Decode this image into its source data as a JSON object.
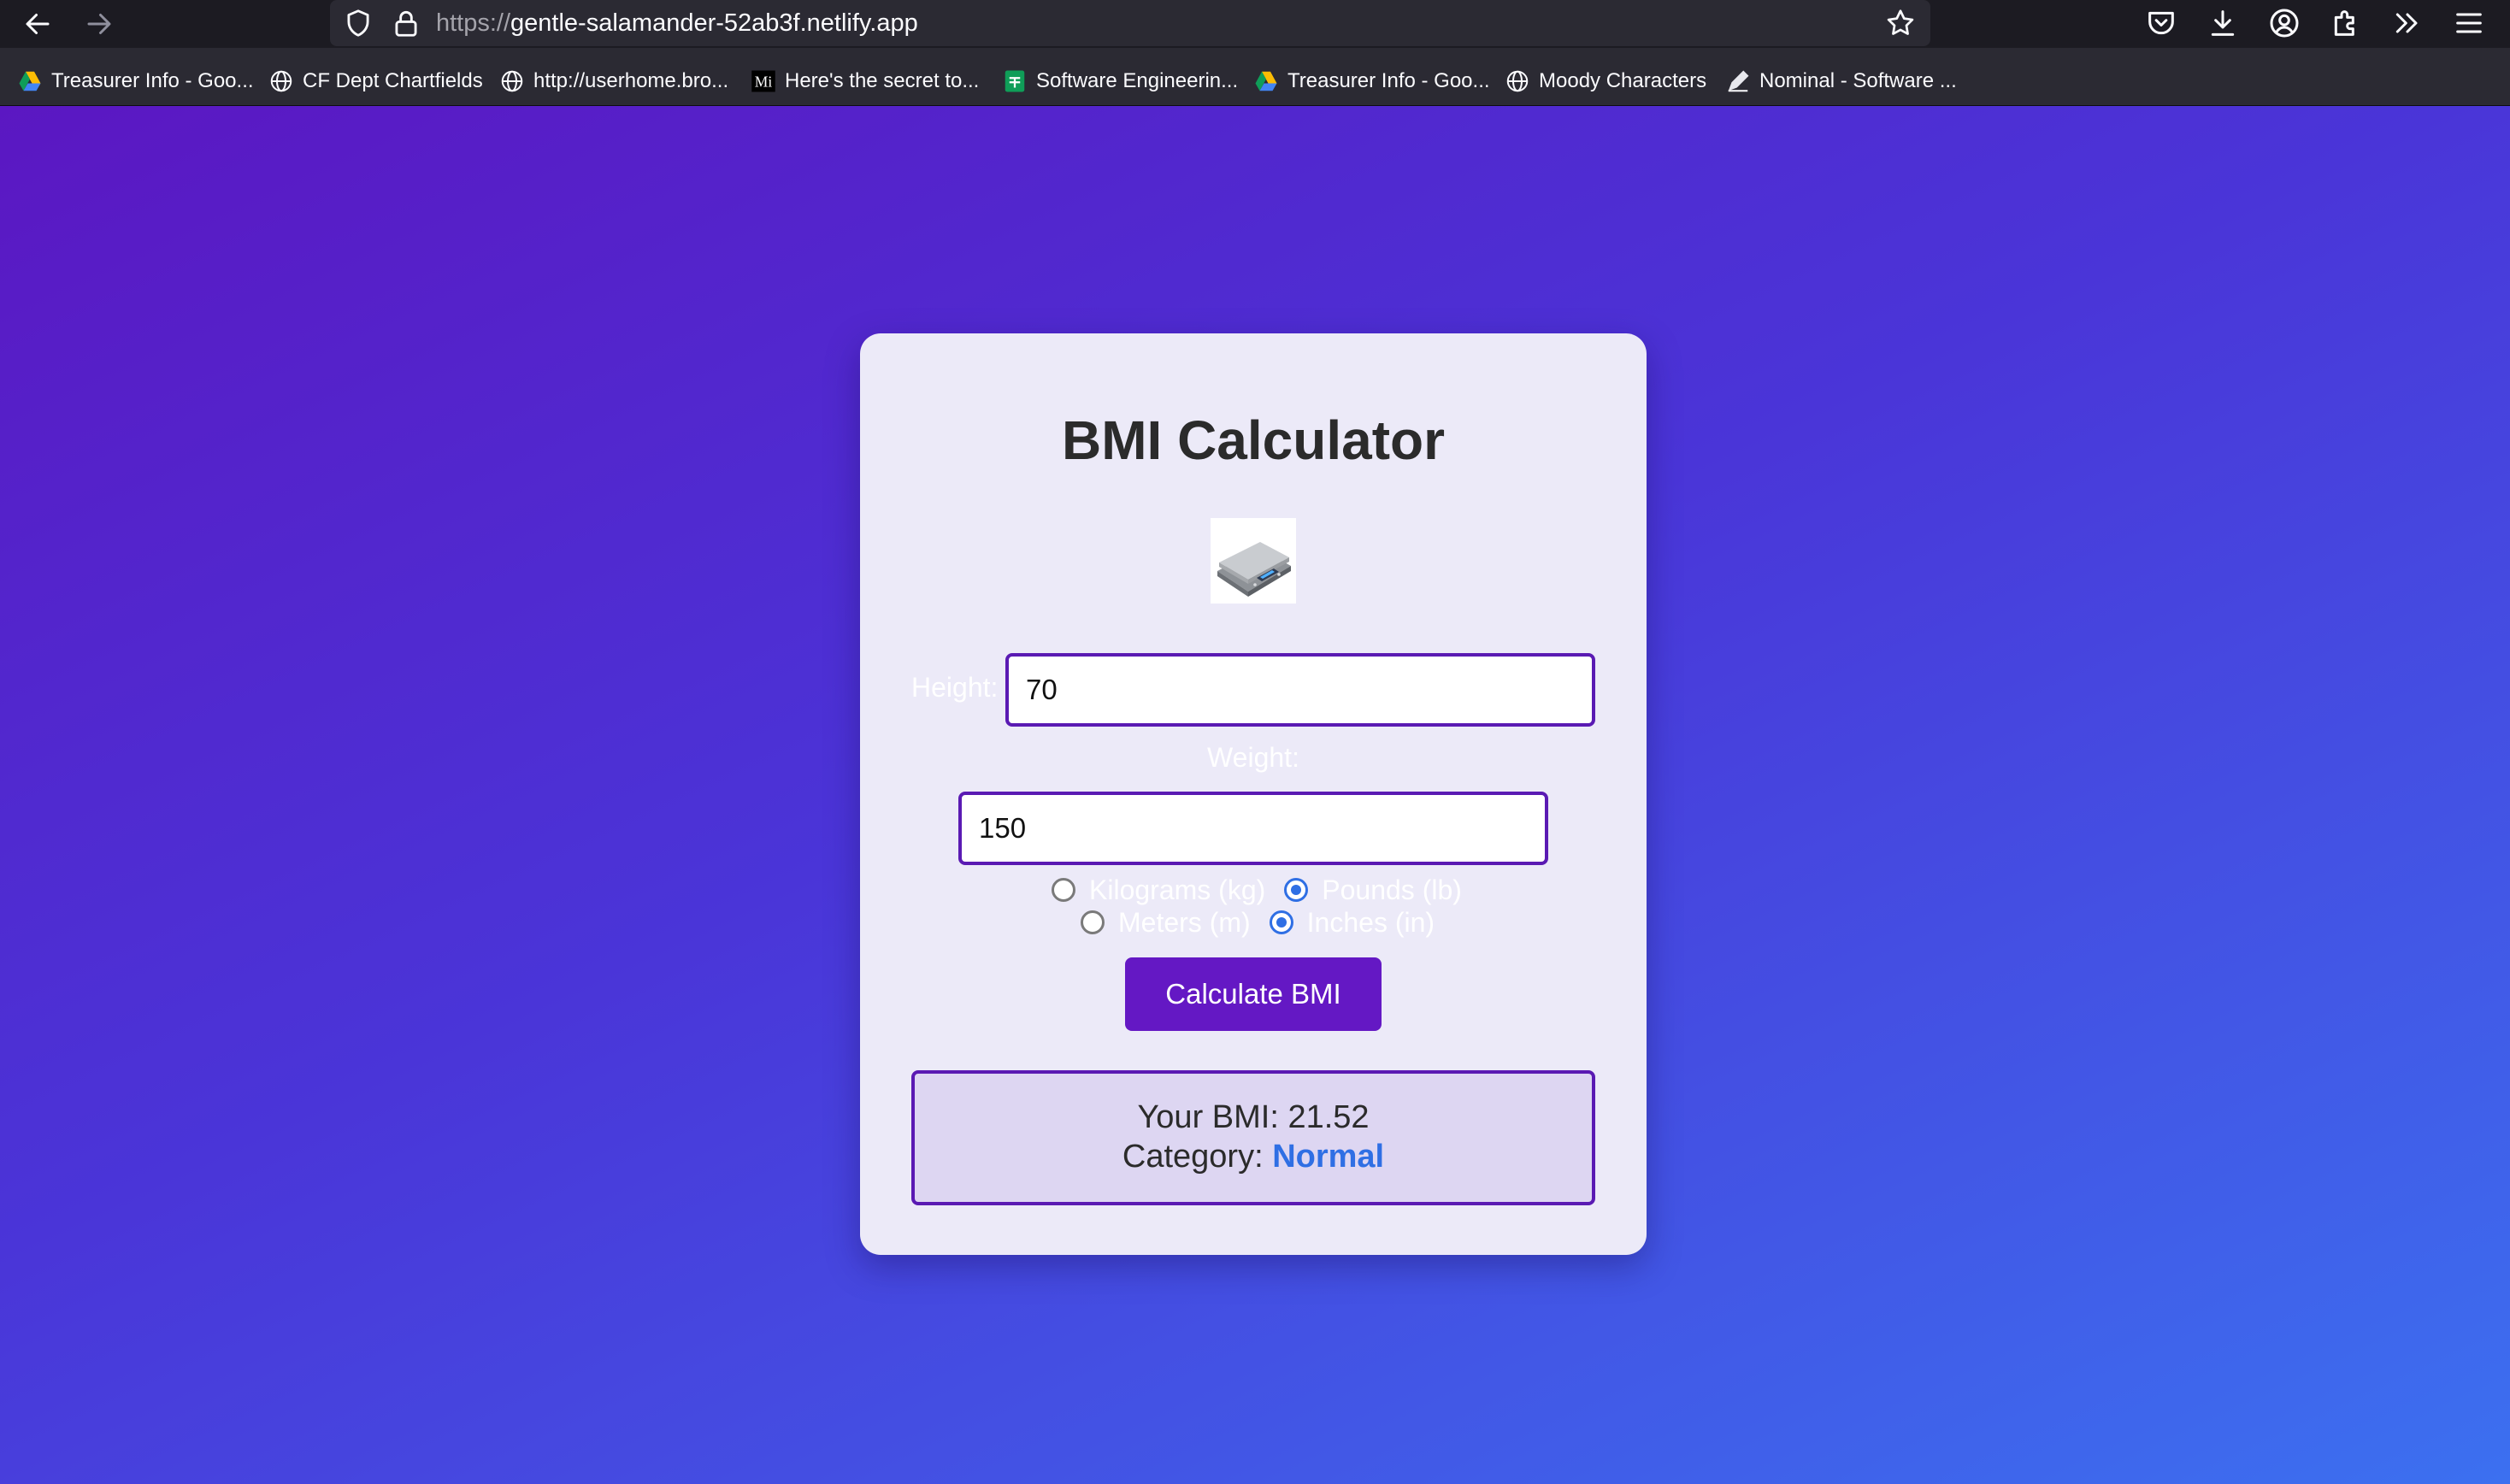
{
  "browser": {
    "url_scheme": "https://",
    "url_host": "gentle-salamander-52ab3f.netlify.app",
    "bookmarks": [
      {
        "label": "Treasurer Info - Goo...",
        "icon": "google-drive-icon"
      },
      {
        "label": "CF Dept Chartfields",
        "icon": "globe-icon"
      },
      {
        "label": "http://userhome.bro...",
        "icon": "globe-icon"
      },
      {
        "label": "Here's the secret to...",
        "icon": "medium-icon"
      },
      {
        "label": "Software Engineerin...",
        "icon": "google-sheets-icon"
      },
      {
        "label": "Treasurer Info - Goo...",
        "icon": "google-drive-icon"
      },
      {
        "label": "Moody Characters",
        "icon": "globe-icon"
      },
      {
        "label": "Nominal - Software ...",
        "icon": "pencil-icon"
      }
    ]
  },
  "app": {
    "title": "BMI Calculator",
    "image": "scale-icon",
    "height": {
      "label": "Height:",
      "value": "70"
    },
    "weight": {
      "label": "Weight:",
      "value": "150"
    },
    "weight_units": [
      {
        "label": "Kilograms (kg)",
        "checked": false
      },
      {
        "label": "Pounds (lb)",
        "checked": true
      }
    ],
    "height_units": [
      {
        "label": "Meters (m)",
        "checked": false
      },
      {
        "label": "Inches (in)",
        "checked": true
      }
    ],
    "calculate_label": "Calculate BMI",
    "result": {
      "bmi_prefix": "Your BMI:",
      "bmi_value": "21.52",
      "category_prefix": "Category:",
      "category": "Normal"
    }
  },
  "colors": {
    "accent": "#5a1ab3",
    "button": "#6418c4",
    "category": "#2f6fe4"
  }
}
